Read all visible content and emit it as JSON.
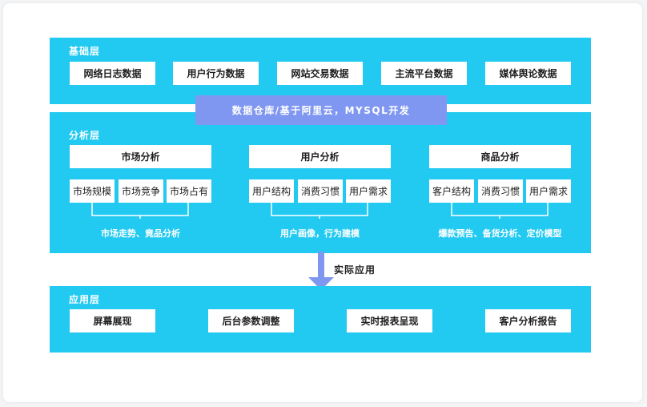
{
  "base_layer": {
    "title": "基础层",
    "items": [
      "网络日志数据",
      "用户行为数据",
      "网站交易数据",
      "主流平台数据",
      "媒体舆论数据"
    ]
  },
  "platform_label": "数据仓库/基于阿里云，MYSQL开发",
  "analysis_layer": {
    "title": "分析层",
    "groups": [
      {
        "title": "市场分析",
        "subs": [
          "市场规模",
          "市场竞争",
          "市场占有"
        ],
        "caption": "市场走势、竟品分析"
      },
      {
        "title": "用户分析",
        "subs": [
          "用户结构",
          "消费习惯",
          "用户需求"
        ],
        "caption": "用户画像，行为建模"
      },
      {
        "title": "商品分析",
        "subs": [
          "客户结构",
          "消费习惯",
          "用户需求"
        ],
        "caption": "爆款预告、备货分析、定价模型"
      }
    ]
  },
  "arrow_label": "实际应用",
  "app_layer": {
    "title": "应用层",
    "items": [
      "屏幕展现",
      "后台参数调整",
      "实时报表呈现",
      "客户分析报告"
    ]
  },
  "colors": {
    "layer_bg": "#22c9f1",
    "platform_bg": "#8097f1",
    "arrow": "#8097f1"
  }
}
